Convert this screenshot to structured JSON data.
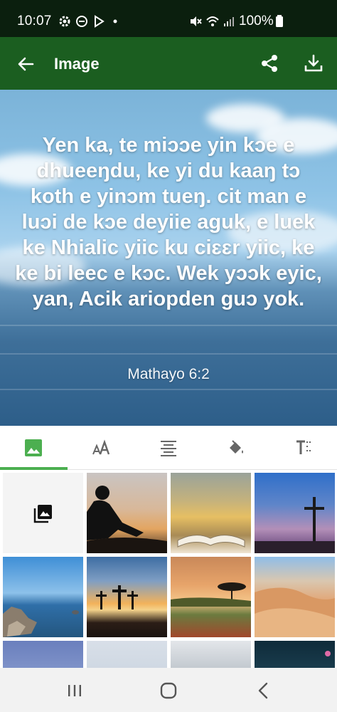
{
  "status_bar": {
    "time": "10:07",
    "battery": "100%",
    "icons": [
      "gear-icon",
      "do-not-disturb-icon",
      "play-store-icon",
      "dot-icon",
      "mute-icon",
      "wifi-icon",
      "signal-icon",
      "battery-icon"
    ]
  },
  "app_bar": {
    "title": "Image",
    "back_icon": "arrow-left-icon",
    "actions": [
      "share-icon",
      "download-icon"
    ]
  },
  "preview": {
    "verse": "Yen ka, te miɔɔe yin kɔe e dhueeŋdu, ke yi du kaaŋ tɔ koth e yinɔm tueŋ. cit man e luɔi de kɔe deyiie aguk, e luek ke Nhialic yiic ku ciɛɛr yiic, ke ke bi leec e kɔc. Wek yɔɔk eyic, yan, Acik ariopden guɔ yok.",
    "reference": "Mathayo 6:2"
  },
  "tabs": [
    {
      "name": "background-image",
      "icon": "image-icon",
      "selected": true
    },
    {
      "name": "font",
      "icon": "font-size-icon",
      "selected": false
    },
    {
      "name": "alignment",
      "icon": "align-center-icon",
      "selected": false
    },
    {
      "name": "color",
      "icon": "paint-bucket-icon",
      "selected": false
    },
    {
      "name": "text-style",
      "icon": "text-format-icon",
      "selected": false
    }
  ],
  "colors": {
    "status_bar": "#0b1f0e",
    "app_bar": "#1b5e20",
    "accent": "#4caf50"
  },
  "backgrounds": [
    "gallery-picker",
    "reading-silhouette-sunset",
    "open-book-golden",
    "cross-dusk",
    "rocky-shore-lake",
    "three-crosses-sunset",
    "acacia-tree-sunset",
    "desert-dunes",
    "purple-sky-partial",
    "pale-sky-partial",
    "snowy-mountains-partial",
    "dark-sea-pink-partial"
  ],
  "nav_bar": [
    "recents-icon",
    "home-icon",
    "back-icon"
  ]
}
